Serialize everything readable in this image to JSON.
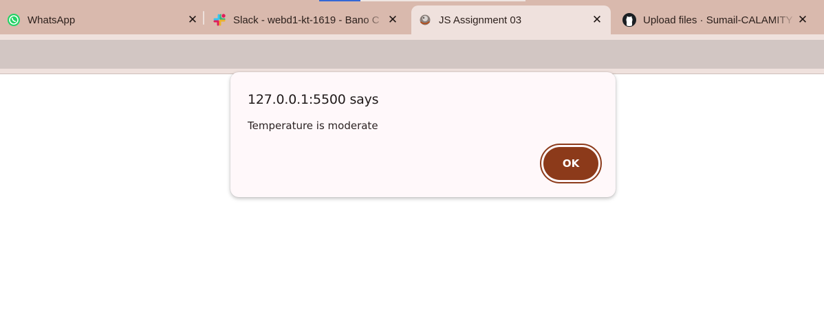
{
  "tabs": [
    {
      "title": "WhatsApp",
      "icon": "whatsapp-icon",
      "active": false
    },
    {
      "title": "Slack - webd1-kt-1619 - Bano C",
      "icon": "slack-icon",
      "active": false
    },
    {
      "title": "JS Assignment 03",
      "icon": "page-globe-icon",
      "active": true
    },
    {
      "title": "Upload files · Sumail-CALAMITY",
      "icon": "github-icon",
      "active": false
    }
  ],
  "close_glyph": "✕",
  "dialog": {
    "heading": "127.0.0.1:5500 says",
    "message": "Temperature is moderate",
    "ok_label": "OK"
  },
  "colors": {
    "accent": "#8c3a1a",
    "tabstrip": "#d9b9ad",
    "active_tab": "#efe1dd"
  }
}
